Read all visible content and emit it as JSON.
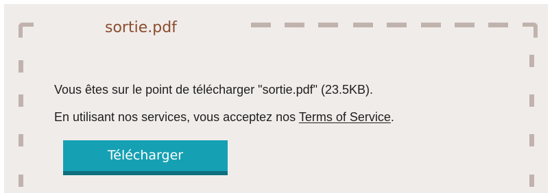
{
  "file": {
    "name": "sortie.pdf"
  },
  "message": {
    "line1": "Vous êtes sur le point de télécharger \"sortie.pdf\" (23.5KB).",
    "line2_prefix": "En utilisant nos services, vous acceptez nos ",
    "terms_link": "Terms of Service",
    "line2_suffix": "."
  },
  "download_button": {
    "label": "Télécharger"
  },
  "colors": {
    "panel_background": "#f0ecea",
    "dashed_border": "#c0b3ad",
    "title_text": "#8a4d2e",
    "button_background": "#16a0b3",
    "button_shadow": "#0e6f7e"
  }
}
